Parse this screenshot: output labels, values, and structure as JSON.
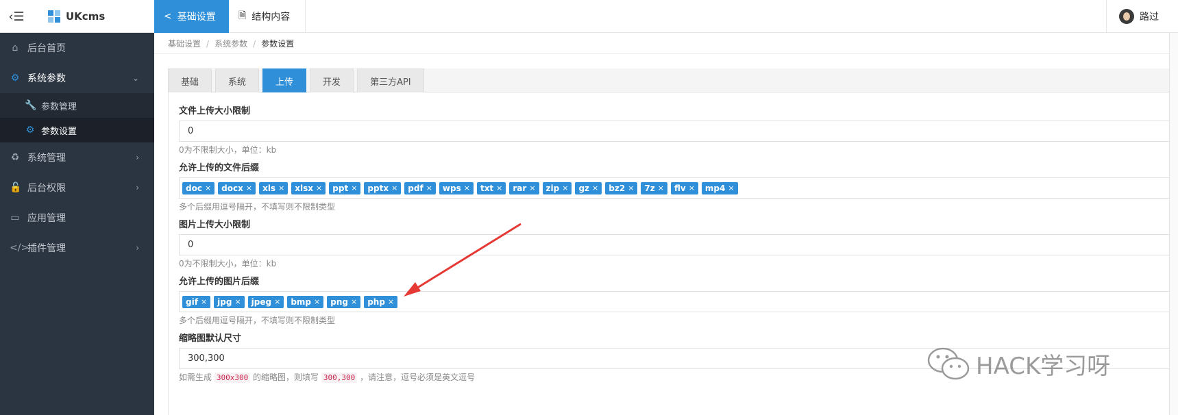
{
  "header": {
    "brand": "UKcms",
    "tabs": [
      {
        "label": "基础设置",
        "active": true
      },
      {
        "label": "结构内容",
        "active": false
      }
    ],
    "user_name": "路过"
  },
  "sidebar": {
    "items": [
      {
        "label": "后台首页",
        "icon": "home-icon"
      },
      {
        "label": "系统参数",
        "icon": "cogs-icon",
        "open": true,
        "children": [
          {
            "label": "参数管理",
            "icon": "wrench-icon"
          },
          {
            "label": "参数设置",
            "icon": "gear-icon",
            "active": true
          }
        ]
      },
      {
        "label": "系统管理",
        "icon": "recycle-icon"
      },
      {
        "label": "后台权限",
        "icon": "unlock-icon"
      },
      {
        "label": "应用管理",
        "icon": "drive-icon"
      },
      {
        "label": "插件管理",
        "icon": "code-icon"
      }
    ]
  },
  "breadcrumb": [
    "基础设置",
    "系统参数",
    "参数设置"
  ],
  "tabs": [
    {
      "label": "基础"
    },
    {
      "label": "系统"
    },
    {
      "label": "上传",
      "active": true
    },
    {
      "label": "开发"
    },
    {
      "label": "第三方API"
    }
  ],
  "form": {
    "file_size": {
      "label": "文件上传大小限制",
      "value": "0",
      "help": "0为不限制大小，单位：kb"
    },
    "file_ext": {
      "label": "允许上传的文件后缀",
      "tags": [
        "doc",
        "docx",
        "xls",
        "xlsx",
        "ppt",
        "pptx",
        "pdf",
        "wps",
        "txt",
        "rar",
        "zip",
        "gz",
        "bz2",
        "7z",
        "flv",
        "mp4"
      ],
      "help": "多个后缀用逗号隔开，不填写则不限制类型"
    },
    "image_size": {
      "label": "图片上传大小限制",
      "value": "0",
      "help": "0为不限制大小，单位：kb"
    },
    "image_ext": {
      "label": "允许上传的图片后缀",
      "tags": [
        "gif",
        "jpg",
        "jpeg",
        "bmp",
        "png",
        "php"
      ],
      "help": "多个后缀用逗号隔开，不填写则不限制类型"
    },
    "thumb": {
      "label": "缩略图默认尺寸",
      "value": "300,300",
      "help_pre": "如需生成",
      "help_code1": "300x300",
      "help_mid": "的缩略图，则填写",
      "help_code2": "300,300",
      "help_post": "，请注意，逗号必须是英文逗号"
    }
  },
  "watermark": {
    "text": "HACK学习呀"
  },
  "colors": {
    "accent": "#2f8fd8",
    "sidebar": "#2b3441",
    "arrow": "#e53935"
  }
}
